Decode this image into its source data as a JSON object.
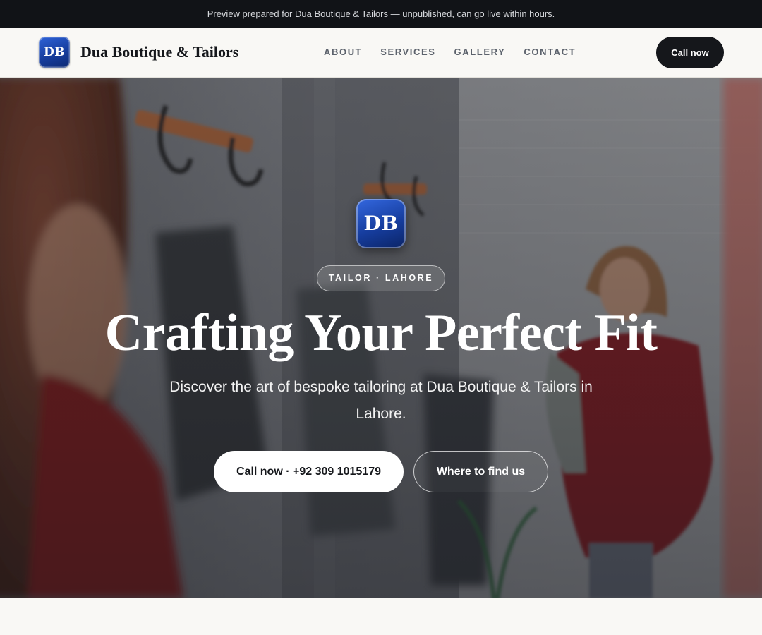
{
  "announcement": "Preview prepared for Dua Boutique & Tailors — unpublished, can go live within hours.",
  "header": {
    "logo_text": "DB",
    "brand_name": "Dua Boutique & Tailors",
    "nav": [
      "ABOUT",
      "SERVICES",
      "GALLERY",
      "CONTACT"
    ],
    "cta_label": "Call now"
  },
  "hero": {
    "logo_text": "DB",
    "tag": "TAILOR · LAHORE",
    "title": "Crafting Your Perfect Fit",
    "subtitle": "Discover the art of bespoke tailoring at Dua Boutique & Tailors in Lahore.",
    "primary_cta": "Call now · +92 309 1015179",
    "secondary_cta": "Where to find us",
    "background_image": "boutique-fitting-room-photo"
  },
  "colors": {
    "announcement_bg": "#111317",
    "nav_bg": "#f9f8f5",
    "brand_blue": "#163d9e",
    "dark_button": "#15171b"
  }
}
